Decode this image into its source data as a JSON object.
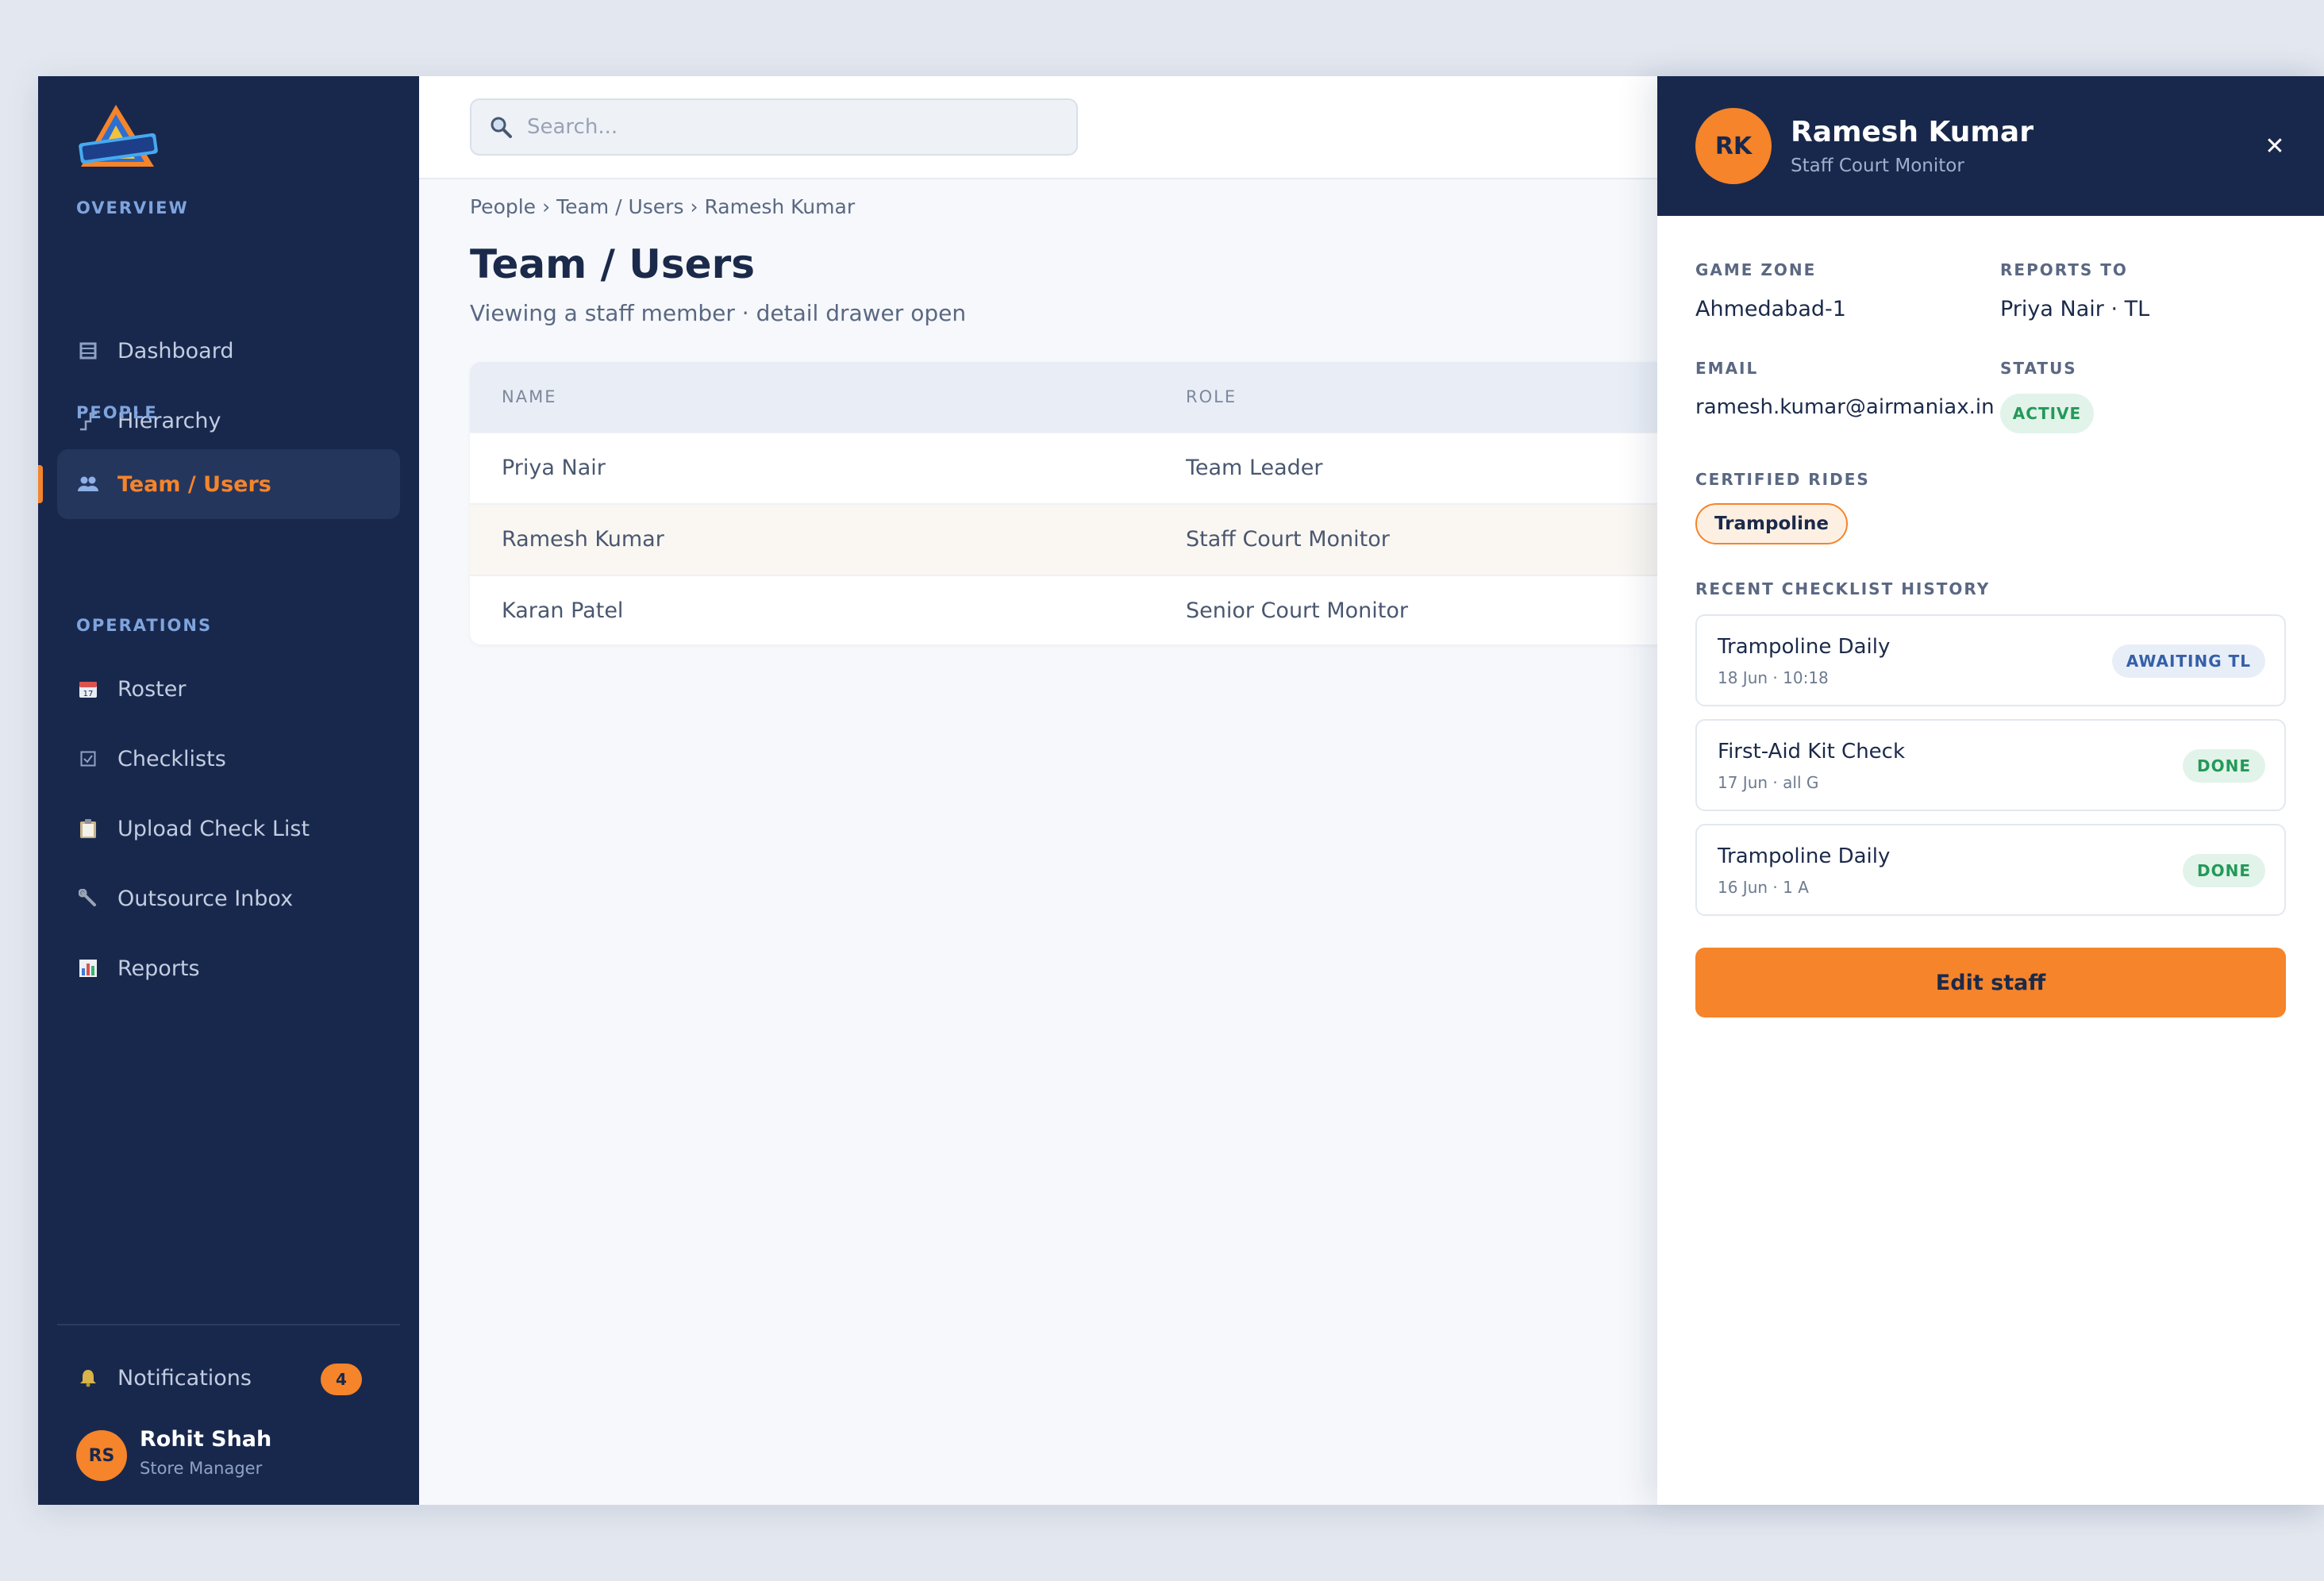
{
  "sidebar": {
    "sections": {
      "overview": "OVERVIEW",
      "people": "PEOPLE",
      "operations": "OPERATIONS"
    },
    "items": [
      {
        "label": "Dashboard",
        "icon": "dashboard-icon"
      },
      {
        "label": "Hierarchy",
        "icon": "hierarchy-icon"
      },
      {
        "label": "Team / Users",
        "icon": "team-icon",
        "active": true
      },
      {
        "label": "Roster",
        "icon": "calendar-icon"
      },
      {
        "label": "Checklists",
        "icon": "checkbox-icon"
      },
      {
        "label": "Upload Check List",
        "icon": "clipboard-icon"
      },
      {
        "label": "Outsource Inbox",
        "icon": "wrench-icon"
      },
      {
        "label": "Reports",
        "icon": "bar-chart-icon"
      }
    ],
    "notifications": {
      "label": "Notifications",
      "count": "4",
      "icon": "bell-icon"
    },
    "user": {
      "initials": "RS",
      "name": "Rohit Shah",
      "role": "Store Manager"
    }
  },
  "search": {
    "placeholder": "Search..."
  },
  "breadcrumb": [
    "People",
    "›",
    "Team / Users",
    "›",
    "Ramesh Kumar"
  ],
  "page": {
    "title": "Team / Users",
    "subtitle": "Viewing a staff member · detail drawer open"
  },
  "table": {
    "columns": [
      "NAME",
      "ROLE"
    ],
    "rows": [
      {
        "name": "Priya Nair",
        "role": "Team Leader"
      },
      {
        "name": "Ramesh Kumar",
        "role": "Staff Court Monitor",
        "selected": true
      },
      {
        "name": "Karan Patel",
        "role": "Senior Court Monitor"
      }
    ]
  },
  "drawer": {
    "initials": "RK",
    "name": "Ramesh Kumar",
    "role": "Staff Court Monitor",
    "close_icon": "close-icon",
    "fields": {
      "game_zone_label": "GAME ZONE",
      "game_zone": "Ahmedabad-1",
      "reports_to_label": "REPORTS TO",
      "reports_to": "Priya Nair · TL",
      "email_label": "EMAIL",
      "email": "ramesh.kumar@airmaniax.in",
      "status_label": "STATUS",
      "status": "ACTIVE"
    },
    "certified_label": "CERTIFIED RIDES",
    "certified": [
      "Trampoline"
    ],
    "history_label": "RECENT CHECKLIST HISTORY",
    "history": [
      {
        "title": "Trampoline Daily",
        "meta": "18 Jun · 10:18",
        "status": "AWAITING TL"
      },
      {
        "title": "First-Aid Kit Check",
        "meta": "17 Jun · all G",
        "status": "DONE"
      },
      {
        "title": "Trampoline Daily",
        "meta": "16 Jun · 1 A",
        "status": "DONE"
      }
    ],
    "edit_label": "Edit staff"
  },
  "colors": {
    "navy": "#18284d",
    "accent": "#f5842a",
    "success": "#239a58",
    "info": "#3560a8"
  }
}
